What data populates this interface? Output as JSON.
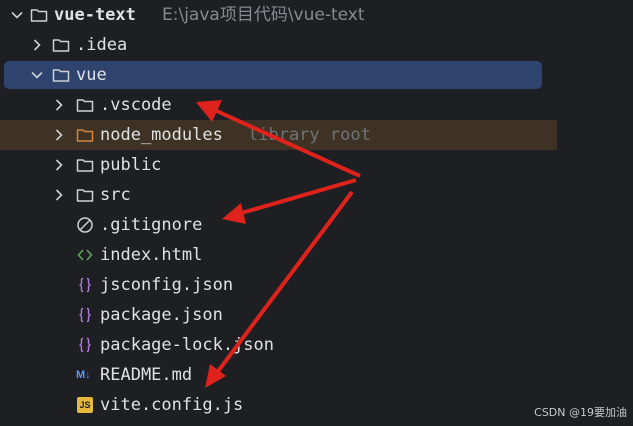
{
  "project": {
    "name": "vue-text",
    "path": "E:\\java项目代码\\vue-text",
    "icon": "folder-icon"
  },
  "tree": {
    "idea": {
      "label": ".idea",
      "icon": "folder-icon"
    },
    "vue": {
      "label": "vue",
      "icon": "folder-icon",
      "selected": true
    },
    "vscode": {
      "label": ".vscode",
      "icon": "folder-icon"
    },
    "node_modules": {
      "label": "node_modules",
      "hint": "library root",
      "icon": "folder-icon-orange"
    },
    "public": {
      "label": "public",
      "icon": "folder-icon"
    },
    "src": {
      "label": "src",
      "icon": "folder-icon"
    },
    "gitignore": {
      "label": ".gitignore",
      "icon": "gitignore-icon"
    },
    "index_html": {
      "label": "index.html",
      "icon": "html-icon"
    },
    "jsconfig": {
      "label": "jsconfig.json",
      "icon": "json-icon"
    },
    "package_json": {
      "label": "package.json",
      "icon": "json-icon"
    },
    "package_lock": {
      "label": "package-lock.json",
      "icon": "json-icon"
    },
    "readme": {
      "label": "README.md",
      "icon": "markdown-icon",
      "badge": "M↓"
    },
    "vite_config": {
      "label": "vite.config.js",
      "icon": "js-icon",
      "badge": "JS"
    }
  },
  "watermark": "CSDN @19要加油",
  "colors": {
    "background": "#1e1f22",
    "selection": "#2e436e",
    "library_highlight": "#3d3223",
    "arrow": "#e0221c",
    "json_icon": "#b07ed9",
    "html_icon": "#5fa35b",
    "js_icon": "#e5b93a",
    "md_icon": "#5a9bf0"
  }
}
